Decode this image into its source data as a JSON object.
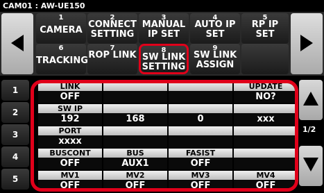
{
  "title": "CAM01 : AW-UE150",
  "menu": [
    {
      "num": "1",
      "label": "CAMERA"
    },
    {
      "num": "2",
      "label": "CONNECT SETTING"
    },
    {
      "num": "3",
      "label": "MANUAL IP SET"
    },
    {
      "num": "4",
      "label": "AUTO IP SET"
    },
    {
      "num": "5",
      "label": "RP IP SET"
    },
    {
      "num": "6",
      "label": "TRACKING"
    },
    {
      "num": "7",
      "label": "ROP LINK"
    },
    {
      "num": "8",
      "label": "SW LINK SETTING"
    },
    {
      "num": "9",
      "label": "SW LINK ASSIGN"
    },
    {
      "num": "",
      "label": ""
    }
  ],
  "rows": [
    {
      "num": "1",
      "cells": [
        {
          "h": "LINK",
          "v": "OFF"
        },
        {
          "h": "",
          "v": ""
        },
        {
          "h": "",
          "v": ""
        },
        {
          "h": "UPDATE",
          "v": "NO?"
        }
      ]
    },
    {
      "num": "2",
      "cells": [
        {
          "h": "SW IP",
          "v": "192"
        },
        {
          "h": "",
          "v": "168"
        },
        {
          "h": "",
          "v": "0"
        },
        {
          "h": "",
          "v": "xxx"
        }
      ]
    },
    {
      "num": "3",
      "cells": [
        {
          "h": "PORT",
          "v": "xxxx"
        },
        {
          "h": "",
          "v": ""
        },
        {
          "h": "",
          "v": ""
        },
        {
          "h": "",
          "v": ""
        }
      ]
    },
    {
      "num": "4",
      "cells": [
        {
          "h": "BUSCONT",
          "v": "OFF"
        },
        {
          "h": "BUS",
          "v": "AUX1"
        },
        {
          "h": "FASIST",
          "v": "OFF"
        },
        {
          "h": "",
          "v": ""
        }
      ]
    },
    {
      "num": "5",
      "cells": [
        {
          "h": "MV1",
          "v": "OFF"
        },
        {
          "h": "MV2",
          "v": "OFF"
        },
        {
          "h": "MV3",
          "v": "OFF"
        },
        {
          "h": "MV4",
          "v": "OFF"
        }
      ]
    }
  ],
  "page_indicator": "1/2",
  "icons": {
    "prev": "left-arrow-icon",
    "next": "right-arrow-icon",
    "up": "up-arrow-icon",
    "down": "down-arrow-icon"
  },
  "colors": {
    "highlight": "#e0001a"
  }
}
